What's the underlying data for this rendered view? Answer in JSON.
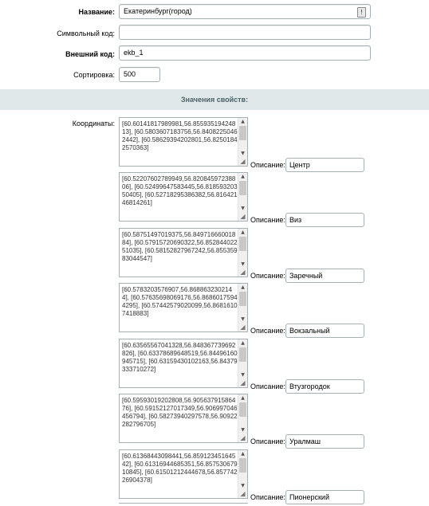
{
  "fields": {
    "name_label": "Название:",
    "name_value": "Екатеринбург(город)",
    "name_lang_icon": "!",
    "symbolic_code_label": "Символьный код:",
    "symbolic_code_value": "",
    "external_code_label": "Внешний код:",
    "external_code_value": "ekb_1",
    "sort_label": "Сортировка:",
    "sort_value": "500"
  },
  "section": {
    "title": "Значения свойств:"
  },
  "coordinates": {
    "label": "Координаты:",
    "description_label": "Описание:",
    "items": [
      {
        "text": "[60.60141817989981,56.85593519424813], [60.5803607183756,56.84082250462442], [60.58629394202801,56.82501842570363]",
        "description": "Центр"
      },
      {
        "text": "[60.52207602789949,56.82084597238806], [60.52499647583445,56.81859320350405], [60.52718295386382,56.81642146814261]",
        "description": "Виз"
      },
      {
        "text": "[60.58751497019375,56.84971666001884], [60.57915720690322,56.85284402251035], [60.58152827967242,56.85535983044547]",
        "description": "Заречный"
      },
      {
        "text": "[60.5783203576907,56.8688632302144], [60.57635698069176,56.86860175944295], [60.57442579020099,56.86816107418883]",
        "description": "Вокзальный"
      },
      {
        "text": "[60.63565567041328,56.848367739692826], [60.63378689648519,56.84496160945715], [60.63159430102163,56.84379333710272]",
        "description": "Втузгородок"
      },
      {
        "text": "[60.59593019202808,56.90563791586476], [60.59152127017349,56.906997046456794], [60.58273940297578,56.90922282796705]",
        "description": "Уралмаш"
      },
      {
        "text": "[60.61368443098441,56.85912345164542], [60.61316944685351,56.85753067910845], [60.61501212444678,56.85774226904378]",
        "description": "Пионерский"
      }
    ]
  }
}
